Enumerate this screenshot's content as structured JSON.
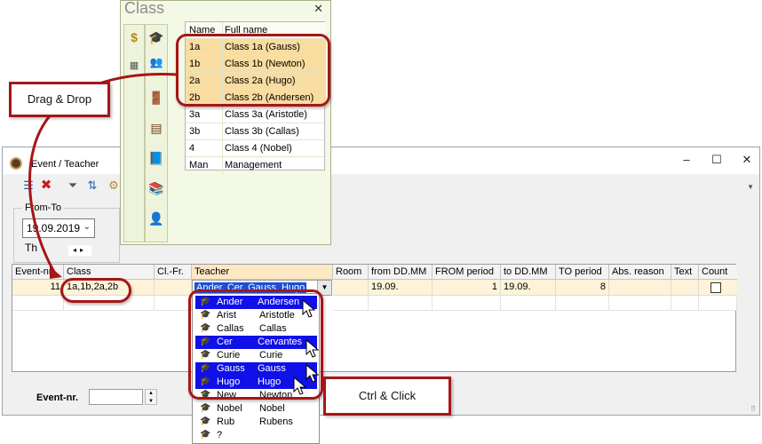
{
  "event_window": {
    "title": "Event / Teacher",
    "controls": {
      "minimize": "–",
      "maximize": "☐",
      "close": "✕"
    },
    "toolbar": [
      {
        "icon": "grid-list-icon",
        "glyph": "☰"
      },
      {
        "icon": "delete-icon",
        "glyph": "✖"
      },
      {
        "icon": "filter-icon",
        "glyph": "⏷"
      },
      {
        "icon": "sort-icon",
        "glyph": "⇅"
      },
      {
        "icon": "settings-icon",
        "glyph": "⚙"
      }
    ],
    "from_to": {
      "label": "From-To",
      "date": "19.09.2019",
      "day": "Th"
    },
    "grid": {
      "columns": [
        "Event-nr.",
        "Class",
        "Cl.-Fr.",
        "Teacher",
        "Room",
        "from DD.MM",
        "FROM period",
        "to DD.MM",
        "TO period",
        "Abs. reason",
        "Text",
        "Count"
      ],
      "row": {
        "event_nr": "11",
        "class": "1a,1b,2a,2b",
        "teacher": "Ander, Cer, Gauss, Hugo",
        "from": "19.09.",
        "from_period": "1",
        "to": "19.09.",
        "to_period": "8"
      }
    },
    "event_nr_label": "Event-nr."
  },
  "class_window": {
    "title": "Class",
    "columns": {
      "name": "Name",
      "full": "Full name"
    },
    "rows": [
      {
        "name": "1a",
        "full": "Class 1a (Gauss)",
        "selected": true
      },
      {
        "name": "1b",
        "full": "Class 1b (Newton)",
        "selected": true
      },
      {
        "name": "2a",
        "full": "Class 2a (Hugo)",
        "selected": true
      },
      {
        "name": "2b",
        "full": "Class 2b (Andersen)",
        "selected": true
      },
      {
        "name": "3a",
        "full": "Class 3a (Aristotle)",
        "selected": false
      },
      {
        "name": "3b",
        "full": "Class 3b (Callas)",
        "selected": false
      },
      {
        "name": "4",
        "full": "Class 4 (Nobel)",
        "selected": false
      },
      {
        "name": "Man",
        "full": "Management",
        "selected": false
      }
    ]
  },
  "teacher_list": [
    {
      "short": "Ander",
      "name": "Andersen",
      "selected": true
    },
    {
      "short": "Arist",
      "name": "Aristotle",
      "selected": false
    },
    {
      "short": "Callas",
      "name": "Callas",
      "selected": false
    },
    {
      "short": "Cer",
      "name": "Cervantes",
      "selected": true
    },
    {
      "short": "Curie",
      "name": "Curie",
      "selected": false
    },
    {
      "short": "Gauss",
      "name": "Gauss",
      "selected": true
    },
    {
      "short": "Hugo",
      "name": "Hugo",
      "selected": true
    },
    {
      "short": "New",
      "name": "Newton",
      "selected": false
    },
    {
      "short": "Nobel",
      "name": "Nobel",
      "selected": false
    },
    {
      "short": "Rub",
      "name": "Rubens",
      "selected": false
    },
    {
      "short": "?",
      "name": "",
      "selected": false
    }
  ],
  "callouts": {
    "drag_drop": "Drag & Drop",
    "ctrl_click": "Ctrl & Click"
  },
  "colors": {
    "accent_red": "#a61616",
    "selection_blue": "#1010e8",
    "class_highlight": "#f8dca0"
  }
}
